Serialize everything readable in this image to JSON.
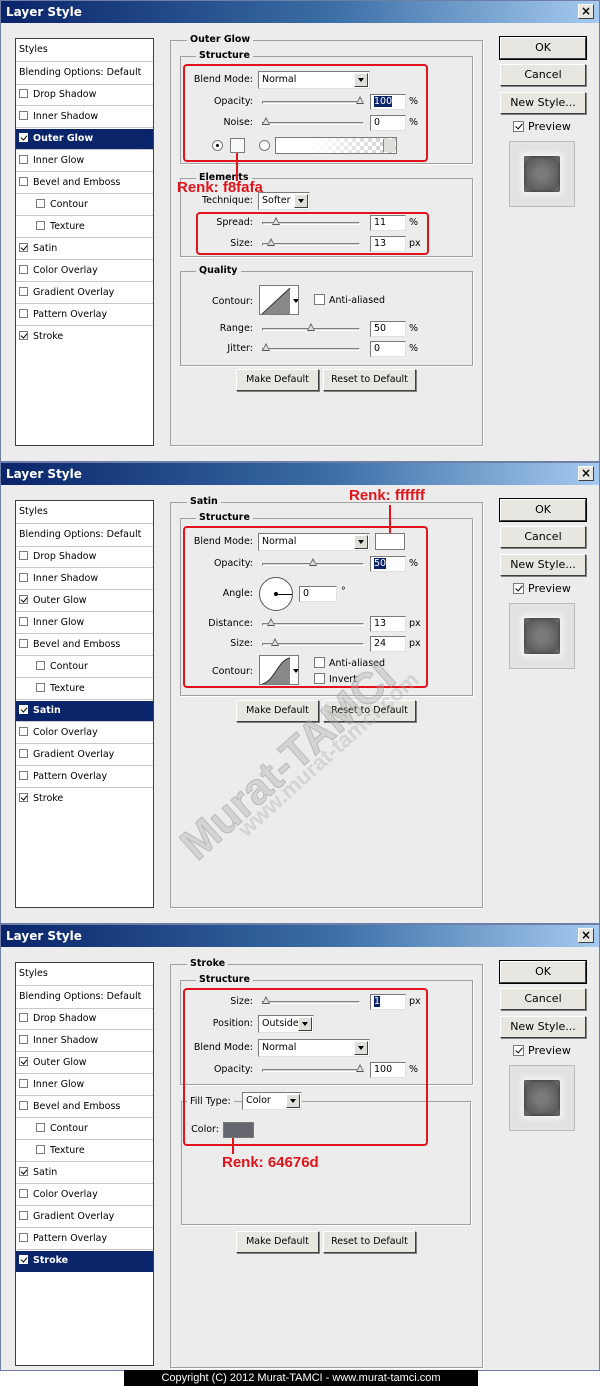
{
  "window_title": "Layer Style",
  "close_glyph": "×",
  "styles_list": {
    "header": "Styles",
    "blending": "Blending Options: Default",
    "items": [
      "Drop Shadow",
      "Inner Shadow",
      "Outer Glow",
      "Inner Glow",
      "Bevel and Emboss",
      "Contour",
      "Texture",
      "Satin",
      "Color Overlay",
      "Gradient Overlay",
      "Pattern Overlay",
      "Stroke"
    ]
  },
  "buttons": {
    "ok": "OK",
    "cancel": "Cancel",
    "new_style": "New Style...",
    "preview": "Preview",
    "make_default": "Make Default",
    "reset_default": "Reset to Default"
  },
  "panel1": {
    "title": "Outer Glow",
    "structure": "Structure",
    "blend_mode_label": "Blend Mode:",
    "blend_mode": "Normal",
    "opacity_label": "Opacity:",
    "opacity": "100",
    "pct": "%",
    "noise_label": "Noise:",
    "noise": "0",
    "elements": "Elements",
    "technique_label": "Technique:",
    "technique": "Softer",
    "spread_label": "Spread:",
    "spread": "11",
    "size_label": "Size:",
    "size": "13",
    "px": "px",
    "quality": "Quality",
    "contour_label": "Contour:",
    "anti_aliased": "Anti-aliased",
    "range_label": "Range:",
    "range": "50",
    "jitter_label": "Jitter:",
    "jitter": "0",
    "annotation": "Renk: f8fafa",
    "glow_color": "#f8fafa"
  },
  "panel2": {
    "title": "Satin",
    "structure": "Structure",
    "blend_mode_label": "Blend Mode:",
    "blend_mode": "Normal",
    "opacity_label": "Opacity:",
    "opacity": "50",
    "pct": "%",
    "angle_label": "Angle:",
    "angle": "0",
    "deg": "°",
    "distance_label": "Distance:",
    "distance": "13",
    "size_label": "Size:",
    "size": "24",
    "px": "px",
    "contour_label": "Contour:",
    "anti_aliased": "Anti-aliased",
    "invert": "Invert",
    "annotation": "Renk: ffffff",
    "satin_color": "#ffffff",
    "watermark": "Murat-TAMCI",
    "watermark_url": "www.murat-tamci.com"
  },
  "panel3": {
    "title": "Stroke",
    "structure": "Structure",
    "size_label": "Size:",
    "size": "1",
    "px": "px",
    "position_label": "Position:",
    "position": "Outside",
    "blend_mode_label": "Blend Mode:",
    "blend_mode": "Normal",
    "opacity_label": "Opacity:",
    "opacity": "100",
    "pct": "%",
    "fill_type_label": "Fill Type:",
    "fill_type": "Color",
    "color_label": "Color:",
    "annotation": "Renk: 64676d",
    "stroke_color": "#64676d"
  },
  "sliders": {
    "p1_opacity": 1.0,
    "p1_noise": 0.0,
    "p1_spread": 0.11,
    "p1_size": 0.05,
    "p1_range": 0.5,
    "p1_jitter": 0.0,
    "p2_opacity": 0.5,
    "p2_distance": 0.05,
    "p2_size": 0.1,
    "p3_size": 0.0,
    "p3_opacity": 1.0
  },
  "copyright": "Copyright (C) 2012 Murat-TAMCI - www.murat-tamci.com"
}
